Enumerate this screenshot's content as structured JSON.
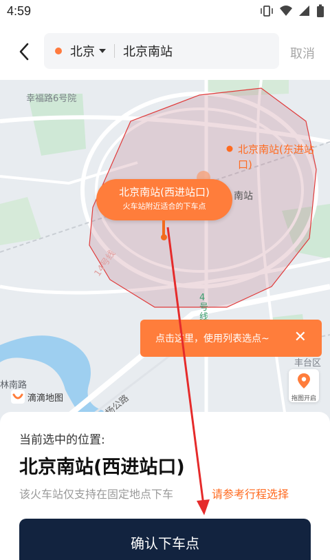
{
  "status": {
    "time": "4:59"
  },
  "header": {
    "city": "北京",
    "search_value": "北京南站",
    "cancel_label": "取消"
  },
  "map": {
    "labels": {
      "street_1": "幸福路6号院",
      "station_name": "南站",
      "line_4": "4号线",
      "line_14": "14号线",
      "road_south": "林南路",
      "area_right": "丰台区",
      "road_bottom": "杨公路"
    },
    "poi_east": "北京南站(东进站口)",
    "bubble_title": "北京南站(西进站口)",
    "bubble_sub": "火车站附近适合的下车点",
    "tip_text": "点击这里，使用列表选点~",
    "tip_close": "✕",
    "drag_label": "拖图开启",
    "logo_text": "滴滴地图"
  },
  "sheet": {
    "current_label": "当前选中的位置:",
    "current_name": "北京南站(西进站口)",
    "note": "该火车站仅支持在固定地点下车",
    "link": "请参考行程选择",
    "confirm_label": "确认下车点"
  },
  "colors": {
    "accent": "#ff7d3b",
    "confirm_bg": "#12233f",
    "zone_stroke": "#e03a3a"
  }
}
